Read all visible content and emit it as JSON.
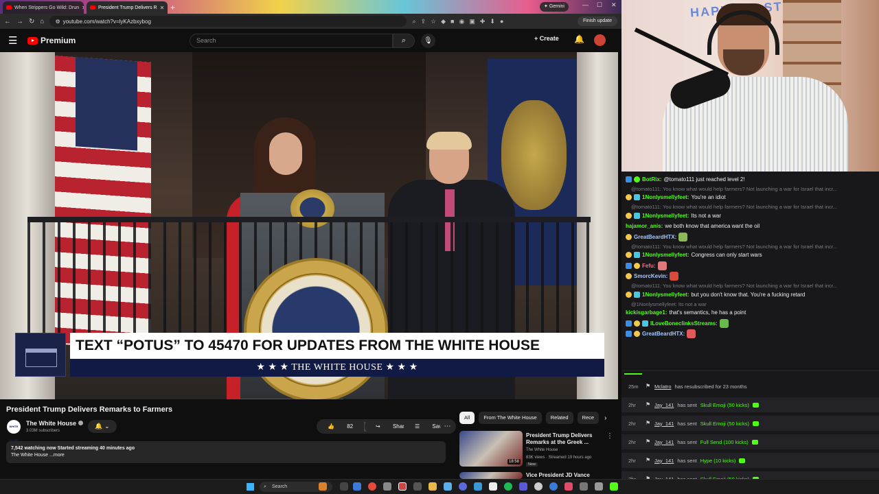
{
  "browser": {
    "tabs": [
      {
        "title": "When Strippers Go Wild: Drun"
      },
      {
        "title": "President Trump Delivers R"
      }
    ],
    "gemini_label": "Gemini",
    "url": "youtube.com/watch?v=lyKAzbxybog",
    "finish_update": "Finish update"
  },
  "youtube": {
    "brand": "Premium",
    "search_placeholder": "Search",
    "create_label": "Create",
    "lower_third": {
      "headline": "TEXT “POTUS” TO 45470 FOR UPDATES FROM THE WHITE HOUSE",
      "footer": "★ ★ ★   THE WHITE HOUSE   ★ ★ ★"
    },
    "video_title": "President Trump Delivers Remarks to Farmers",
    "channel": {
      "name": "The White House",
      "subs": "3.03M subscribers",
      "avatar_text": "WHITE HOUSE"
    },
    "likes": "82",
    "share_label": "Share",
    "save_label": "Save",
    "description": {
      "stats": "7,542 watching now  Started streaming 40 minutes ago",
      "snippet": "The White House ...more"
    },
    "chips": [
      "All",
      "From The White House",
      "Related",
      "Rece"
    ],
    "recommendations": [
      {
        "title": "President Trump Delivers Remarks at the Greek ...",
        "channel": "The White House",
        "views": "83K views · Streamed 19 hours ago",
        "badge": "New",
        "duration": "18:58"
      },
      {
        "title": "Vice President JD Vance",
        "channel": "",
        "views": "",
        "badge": "",
        "duration": ""
      }
    ]
  },
  "webcam": {
    "wall_text": "HAPPY EAST"
  },
  "chat": {
    "messages": [
      {
        "type": "msg",
        "user": "BotRix:",
        "text": "@tomato111 just reached level 2!",
        "color": "#53fc18",
        "badges": [
          "kick",
          "bot"
        ]
      },
      {
        "type": "reply",
        "text": "@tomato111: You know what would help farmers? Not launching a war for Israel that incr..."
      },
      {
        "type": "msg",
        "user": "1Nonlysmellyfeet:",
        "text": "You're an idiot",
        "color": "#53fc18",
        "badges": [
          "crown",
          "sub"
        ]
      },
      {
        "type": "reply",
        "text": "@tomato111: You know what would help farmers? Not launching a war for Israel that incr..."
      },
      {
        "type": "msg",
        "user": "1Nonlysmellyfeet:",
        "text": "Its not a war",
        "color": "#53fc18",
        "badges": [
          "crown",
          "sub"
        ]
      },
      {
        "type": "msg",
        "user": "hajamor_anis:",
        "text": "we both know that america want the oil",
        "color": "#53fc18",
        "badges": []
      },
      {
        "type": "msg",
        "user": "GreatBeardHTX:",
        "text": "",
        "color": "#a6c8ff",
        "badges": [
          "crown"
        ],
        "emote": "#8cb85a"
      },
      {
        "type": "reply",
        "text": "@tomato111: You know what would help farmers? Not launching a war for Israel that incr..."
      },
      {
        "type": "msg",
        "user": "1Nonlysmellyfeet:",
        "text": "Congress can only start wars",
        "color": "#53fc18",
        "badges": [
          "crown",
          "sub"
        ]
      },
      {
        "type": "msg",
        "user": "Fefu:",
        "text": "",
        "color": "#ff6a8a",
        "badges": [
          "kick",
          "crown"
        ],
        "emote": "#e07a7a"
      },
      {
        "type": "msg",
        "user": "SmorcKevin:",
        "text": "",
        "color": "#a6c8ff",
        "badges": [
          "crown"
        ],
        "emote": "#d84a3a"
      },
      {
        "type": "reply",
        "text": "@tomato111: You know what would help farmers? Not launching a war for Israel that incr..."
      },
      {
        "type": "msg",
        "user": "1Nonlysmellyfeet:",
        "text": "but you don't know that. You're a fucking retard",
        "color": "#53fc18",
        "badges": [
          "crown",
          "sub"
        ]
      },
      {
        "type": "reply",
        "text": "@1Nonlysmellyfeet: Its not a war"
      },
      {
        "type": "msg",
        "user": "kickisgarbage1:",
        "text": "that's semantics, he has a point",
        "color": "#53fc18",
        "badges": []
      },
      {
        "type": "msg",
        "user": "ILoveBoneclinksStreams:",
        "text": "",
        "color": "#53fc18",
        "badges": [
          "kick",
          "crown",
          "sub"
        ],
        "emote": "#6ab84a"
      },
      {
        "type": "msg",
        "user": "GreatBeardHTX:",
        "text": "",
        "color": "#a6c8ff",
        "badges": [
          "kick",
          "crown"
        ],
        "emote": "#e05a5a"
      }
    ]
  },
  "events": [
    {
      "time": "25m",
      "user": "Mclatro",
      "action": "has resubscribed for 23 months",
      "highlight": "",
      "gem": false
    },
    {
      "time": "2hr",
      "user": "Jay_141",
      "action": "has sent",
      "highlight": "Skull Emoji (50 kicks)",
      "gem": true
    },
    {
      "time": "2hr",
      "user": "Jay_141",
      "action": "has sent",
      "highlight": "Skull Emoji (50 kicks)",
      "gem": true
    },
    {
      "time": "2hr",
      "user": "Jay_141",
      "action": "has sent",
      "highlight": "Full Send (100 kicks)",
      "gem": true
    },
    {
      "time": "2hr",
      "user": "Jay_141",
      "action": "has sent",
      "highlight": "Hype (10 kicks)",
      "gem": true
    },
    {
      "time": "2hr",
      "user": "Jay_141",
      "action": "has sent",
      "highlight": "Skull Emoji (50 kicks)",
      "gem": true
    }
  ],
  "taskbar": {
    "search_label": "Search"
  }
}
